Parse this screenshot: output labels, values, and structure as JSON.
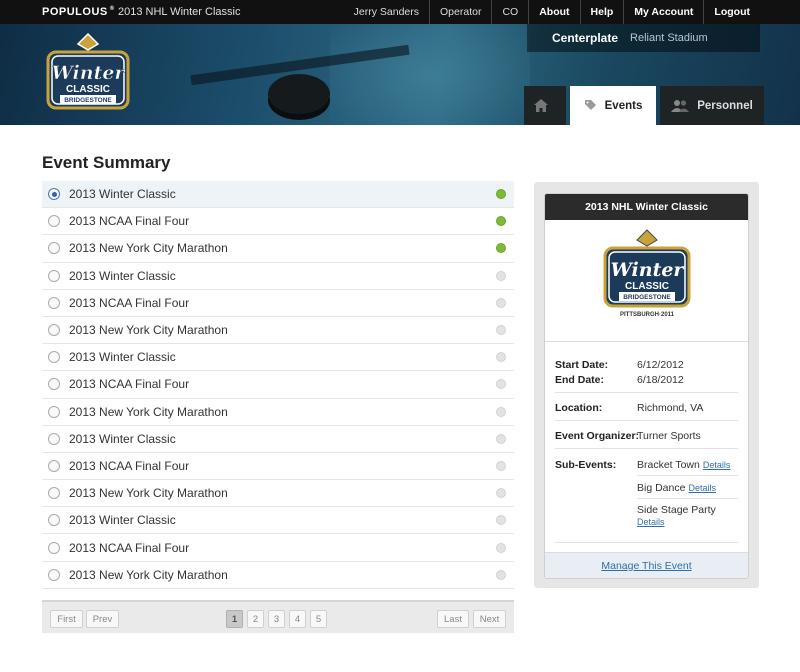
{
  "topbar": {
    "brand": "POPULOUS",
    "brand_mark": "®",
    "title": "2013 NHL Winter Classic",
    "links": [
      {
        "label": "Jerry Sanders"
      },
      {
        "label": "Operator"
      },
      {
        "label": "CO"
      },
      {
        "label": "About"
      },
      {
        "label": "Help"
      },
      {
        "label": "My Account"
      },
      {
        "label": "Logout"
      }
    ]
  },
  "venue": {
    "main": "Centerplate",
    "sub": "Reliant Stadium"
  },
  "tabs": {
    "home_icon": "home-icon",
    "events": "Events",
    "personnel": "Personnel"
  },
  "page_title": "Event Summary",
  "events": [
    {
      "name": "2013 Winter Classic",
      "selected": true,
      "status": "active"
    },
    {
      "name": "2013 NCAA Final Four",
      "selected": false,
      "status": "active"
    },
    {
      "name": "2013 New York City Marathon",
      "selected": false,
      "status": "active"
    },
    {
      "name": "2013 Winter Classic",
      "selected": false,
      "status": "inactive"
    },
    {
      "name": "2013 NCAA Final Four",
      "selected": false,
      "status": "inactive"
    },
    {
      "name": "2013 New York City Marathon",
      "selected": false,
      "status": "inactive"
    },
    {
      "name": "2013 Winter Classic",
      "selected": false,
      "status": "inactive"
    },
    {
      "name": "2013 NCAA Final Four",
      "selected": false,
      "status": "inactive"
    },
    {
      "name": "2013 New York City Marathon",
      "selected": false,
      "status": "inactive"
    },
    {
      "name": "2013 Winter Classic",
      "selected": false,
      "status": "inactive"
    },
    {
      "name": "2013 NCAA Final Four",
      "selected": false,
      "status": "inactive"
    },
    {
      "name": "2013 New York City Marathon",
      "selected": false,
      "status": "inactive"
    },
    {
      "name": "2013 Winter Classic",
      "selected": false,
      "status": "inactive"
    },
    {
      "name": "2013 NCAA Final Four",
      "selected": false,
      "status": "inactive"
    },
    {
      "name": "2013 New York City Marathon",
      "selected": false,
      "status": "inactive"
    }
  ],
  "pager": {
    "first": "First",
    "prev": "Prev",
    "last": "Last",
    "next": "Next",
    "pages": [
      "1",
      "2",
      "3",
      "4",
      "5"
    ],
    "current": "1"
  },
  "detail": {
    "title": "2013 NHL Winter Classic",
    "logo": {
      "top": "Winter",
      "bottom": "CLASSIC",
      "sponsor": "BRIDGESTONE",
      "city": "PITTSBURGH·2011"
    },
    "start_label": "Start Date:",
    "start_value": "6/12/2012",
    "end_label": "End Date:",
    "end_value": "6/18/2012",
    "location_label": "Location:",
    "location_value": "Richmond, VA",
    "organizer_label": "Event Organizer:",
    "organizer_value": "Turner Sports",
    "subevents_label": "Sub-Events:",
    "subevents": [
      {
        "name": "Bracket Town",
        "link": "Details"
      },
      {
        "name": "Big Dance",
        "link": "Details"
      },
      {
        "name": "Side Stage Party",
        "link": "Details"
      }
    ],
    "manage": "Manage This Event"
  },
  "colors": {
    "active_dot": "#7dba3a",
    "link": "#2f6fa8",
    "topbar": "#111111"
  }
}
